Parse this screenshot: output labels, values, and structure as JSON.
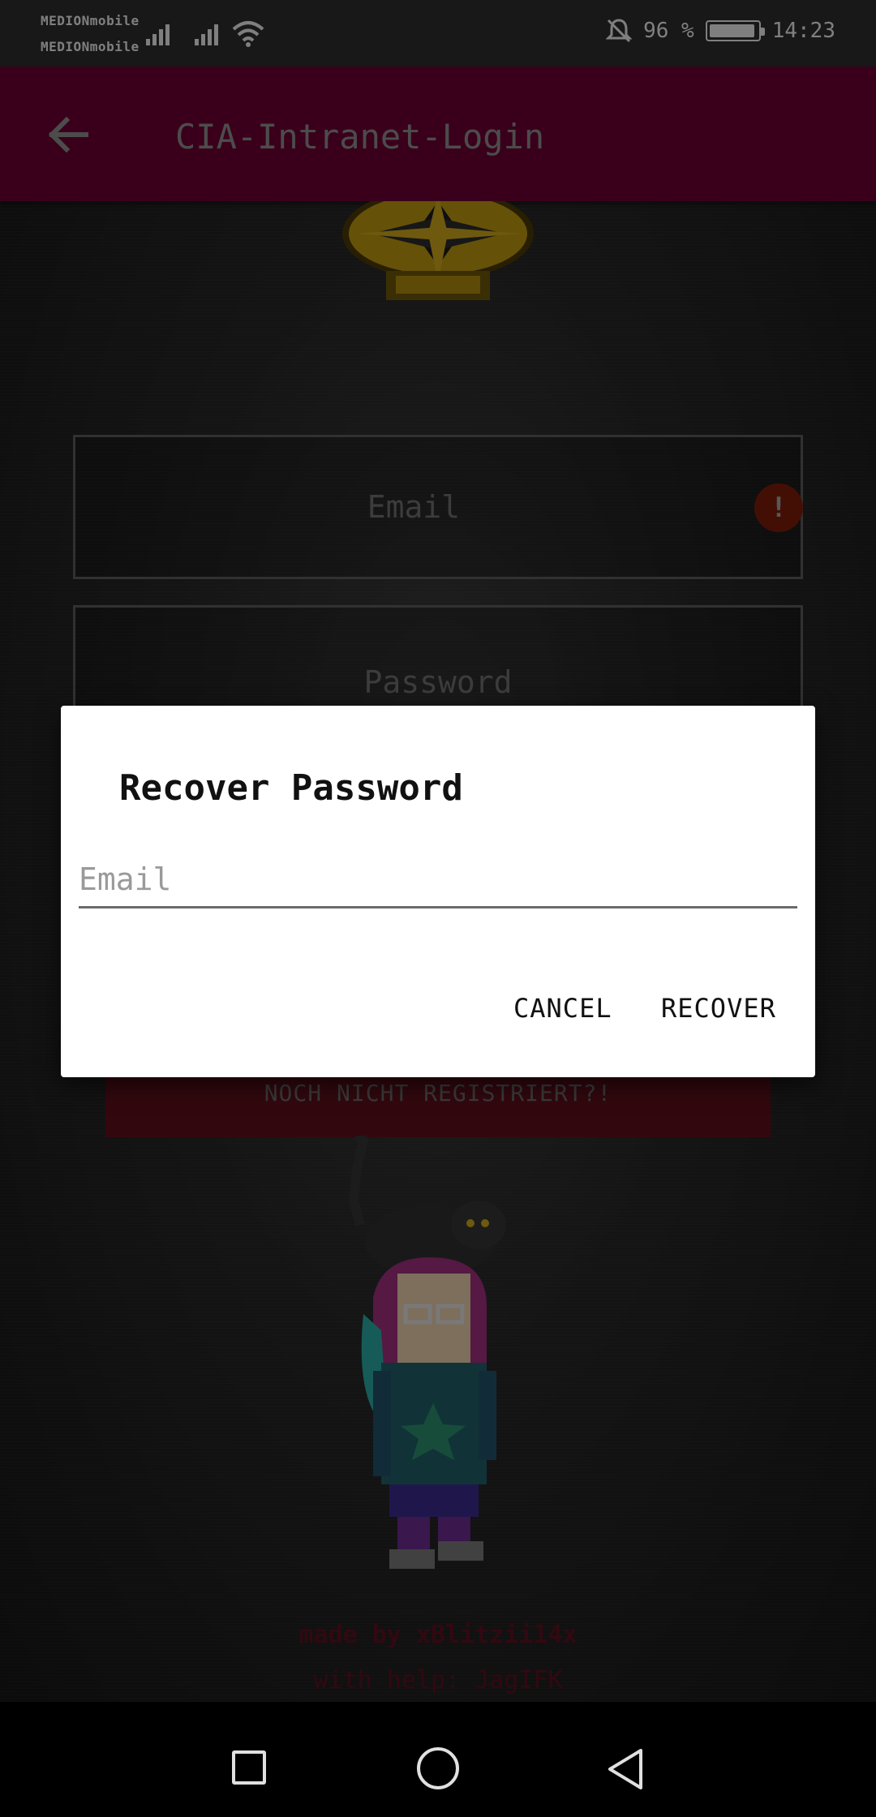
{
  "status_bar": {
    "carrier1": "MEDIONmobile",
    "carrier2": "MEDIONmobile",
    "battery_text": "96 %",
    "battery_level": 0.96,
    "time": "14:23",
    "icons": [
      "signal-icon",
      "signal-icon",
      "wifi-icon",
      "notifications-off-icon",
      "battery-icon"
    ]
  },
  "app_bar": {
    "title": "CIA-Intranet-Login",
    "color": "#6a0032"
  },
  "login": {
    "email_placeholder": "Email",
    "password_placeholder": "Password",
    "error_symbol": "!",
    "register_button": "NOCH NICHT REGISTRIERT?!"
  },
  "dialog": {
    "title": "Recover Password",
    "email_placeholder": "Email",
    "cancel_label": "CANCEL",
    "recover_label": "RECOVER"
  },
  "credits": {
    "line1": "made by xBlitzii14x",
    "line2": "with help: JagIFK"
  }
}
